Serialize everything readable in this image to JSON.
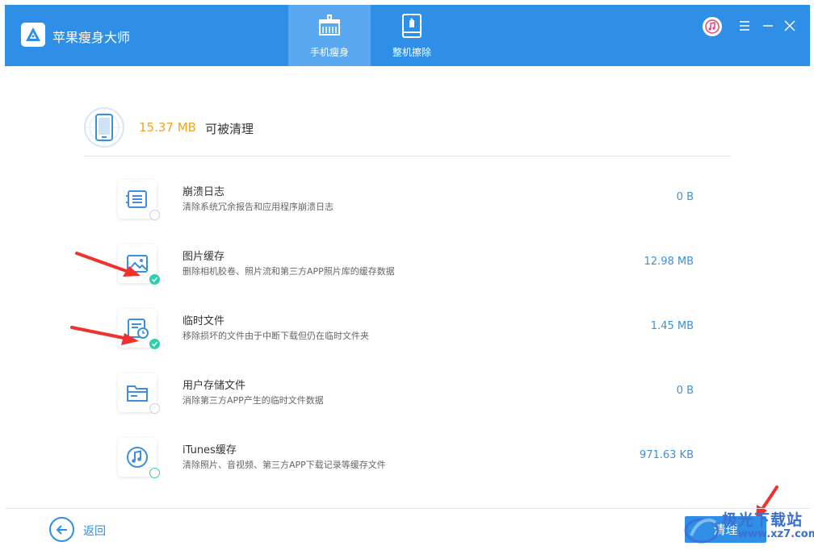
{
  "app": {
    "title": "苹果瘦身大师"
  },
  "tabs": [
    {
      "label": "手机瘦身",
      "icon": "broom-icon",
      "active": true
    },
    {
      "label": "整机擦除",
      "icon": "phone-erase-icon",
      "active": false
    }
  ],
  "summary": {
    "size": "15.37 MB",
    "label": "可被清理"
  },
  "items": [
    {
      "title": "崩溃日志",
      "desc": "清除系统冗余报告和应用程序崩溃日志",
      "size": "0 B",
      "icon": "crash-log-icon",
      "checked": false
    },
    {
      "title": "图片缓存",
      "desc": "删除相机胶卷、照片流和第三方APP照片库的缓存数据",
      "size": "12.98 MB",
      "icon": "image-cache-icon",
      "checked": true
    },
    {
      "title": "临时文件",
      "desc": "移除损坏的文件由于中断下载但仍在临时文件夹",
      "size": "1.45 MB",
      "icon": "temp-file-icon",
      "checked": true
    },
    {
      "title": "用户存储文件",
      "desc": "消除第三方APP产生的临时文件数据",
      "size": "0 B",
      "icon": "folder-icon",
      "checked": false
    },
    {
      "title": "iTunes缓存",
      "desc": "清除照片、音视频、第三方APP下载记录等缓存文件",
      "size": "971.63 KB",
      "icon": "music-note-icon",
      "checked": false
    }
  ],
  "footer": {
    "back_label": "返回",
    "clean_label": "清理"
  },
  "watermark": {
    "text": "极光下载站",
    "url": "www.xz7.com"
  },
  "colors": {
    "primary": "#2f8fe6",
    "accent_size": "#f0a523",
    "check": "#2ecfae",
    "arrow": "#f0312d"
  }
}
